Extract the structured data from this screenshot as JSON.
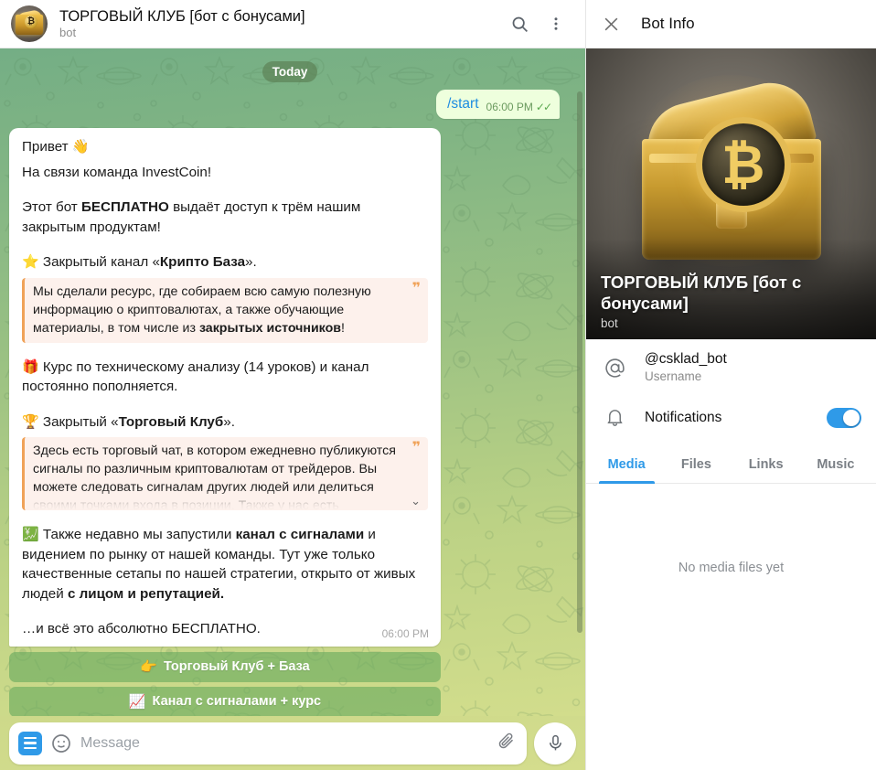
{
  "chat_header": {
    "title": "ТОРГОВЫЙ КЛУБ [бот с бонусами]",
    "subtitle": "bot",
    "avatar_icon": "treasure-chest-bitcoin-avatar",
    "search_icon": "search-icon",
    "menu_icon": "more-vertical-icon"
  },
  "chat": {
    "date_divider": "Today",
    "outgoing": {
      "text": "/start",
      "time": "06:00 PM",
      "status_icon": "double-check-icon"
    },
    "incoming": {
      "time": "06:00 PM",
      "paragraphs": [
        {
          "emoji": "👋",
          "prefix": "Привет ",
          "text": ""
        },
        {
          "text": "На связи команда InvestCoin!"
        },
        {
          "text": "Этот бот ",
          "bold": "БЕСПЛАТНО",
          "suffix": " выдаёт доступ к трём нашим закрытым продуктам!"
        }
      ],
      "p1": "Привет 👋",
      "p2": "На связи команда InvestCoin!",
      "p3_a": "Этот бот ",
      "p3_b": "БЕСПЛАТНО",
      "p3_c": " выдаёт доступ к трём нашим закрытым продуктам!",
      "item1_emoji": "⭐",
      "item1_a": " Закрытый канал «",
      "item1_b": "Крипто База",
      "item1_c": "».",
      "quote1_a": "Мы сделали ресурс, где собираем всю самую полезную информацию о криптовалютах, а также обучающие материалы, в том числе из ",
      "quote1_b": "закрытых источников",
      "quote1_c": "!",
      "quote_mark": "❞",
      "item2_emoji": "🎁",
      "item2_text": " Курс по техническому анализу (14 уроков) и канал постоянно пополняется.",
      "item3_emoji": "🏆",
      "item3_a": " Закрытый «",
      "item3_b": "Торговый Клуб",
      "item3_c": "».",
      "quote2_text": "Здесь есть торговый чат, в котором ежедневно публикуются сигналы по различным криптовалютам от трейдеров. Вы можете следовать сигналам других людей или делиться своими точками входа в позиции. Также у нас есть отдельные",
      "quote2_expand_icon": "chevron-down-icon",
      "item4_emoji": "💹",
      "item4_a": " Также недавно мы запустили ",
      "item4_b": "канал с сигналами",
      "item4_c": " и видением по рынку от нашей команды. Тут уже только качественные сетапы по нашей стратегии, открыто от живых людей ",
      "item4_d": "с лицом и репутацией.",
      "final_text": "…и всё это абсолютно БЕСПЛАТНО."
    },
    "keyboard": [
      {
        "emoji": "👉",
        "label": "Торговый Клуб + База"
      },
      {
        "emoji": "📈",
        "label": "Канал с сигналами + курс"
      }
    ]
  },
  "composer": {
    "menu_icon": "bot-menu-icon",
    "emoji_icon": "smile-icon",
    "placeholder": "Message",
    "value": "",
    "attach_icon": "paperclip-icon",
    "mic_icon": "microphone-icon"
  },
  "info_panel": {
    "close_icon": "close-icon",
    "title": "Bot Info",
    "hero": {
      "image_icon": "treasure-chest-bitcoin-image",
      "name": "ТОРГОВЫЙ КЛУБ [бот с бонусами]",
      "subtitle": "bot",
      "coin_symbol": "₿"
    },
    "rows": [
      {
        "icon": "at-sign-icon",
        "main": "@csklad_bot",
        "sub": "Username"
      }
    ],
    "notifications": {
      "icon": "bell-icon",
      "label": "Notifications",
      "enabled": true
    },
    "tabs": [
      {
        "label": "Media",
        "active": true
      },
      {
        "label": "Files",
        "active": false
      },
      {
        "label": "Links",
        "active": false
      },
      {
        "label": "Music",
        "active": false
      }
    ],
    "empty_state": "No media files yet"
  },
  "colors": {
    "accent_blue": "#2f9ae8",
    "quote_bar": "#f0a258",
    "quote_bg": "#fdf1ec",
    "outgoing_bubble": "#eeffdd",
    "keyboard_button": "rgba(103,169,93,.62)"
  }
}
